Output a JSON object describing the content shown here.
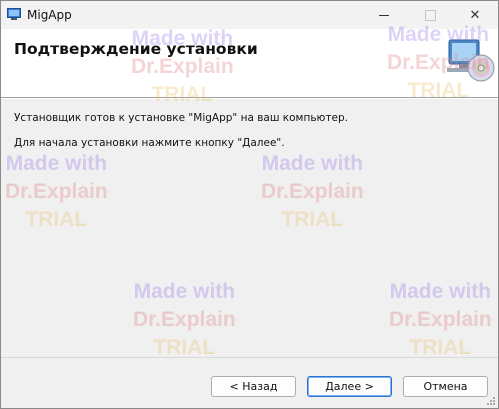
{
  "window": {
    "title": "MigApp",
    "app_icon": "installer-app-icon",
    "controls": {
      "minimize": "minimize-icon",
      "maximize": "maximize-icon",
      "close_glyph": "✕"
    }
  },
  "banner": {
    "title": "Подтверждение установки",
    "art_icon": "computer-disc-icon"
  },
  "body": {
    "message1": "Установщик готов к установке \"MigApp\" на ваш компьютер.",
    "message2": "Для начала установки нажмите кнопку \"Далее\"."
  },
  "buttons": {
    "back": "< Назад",
    "next": "Далее >",
    "cancel": "Отмена"
  },
  "watermark": {
    "line1": "Made with",
    "line2": "Dr.Explain",
    "line3": "TRIAL"
  },
  "colors": {
    "focus_border": "#2b72d1",
    "watermark_line1": "#9a78e8",
    "watermark_line2": "#e08080",
    "watermark_line3": "#e8c070"
  }
}
